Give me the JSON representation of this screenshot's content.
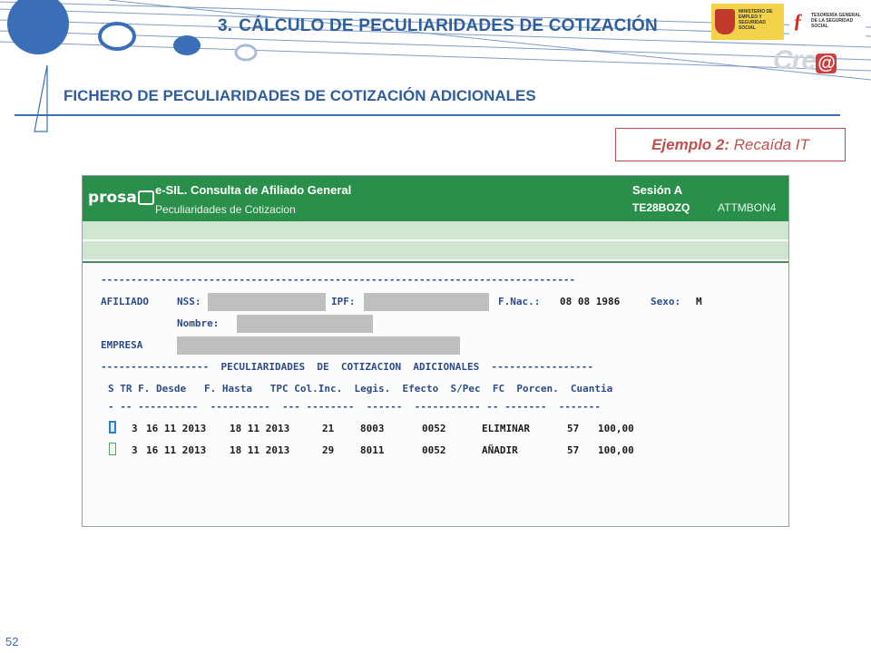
{
  "slide": {
    "title_num": "3.",
    "title": "CÁLCULO DE PECULIARIDADES DE COTIZACIÓN",
    "subtitle": "FICHERO DE PECULIARIDADES DE COTIZACIÓN ADICIONALES",
    "example_label": "Ejemplo 2:",
    "example_text": "Recaída IT",
    "page_number": "52",
    "crea_logo": "Cre",
    "crea_logo_at": "@"
  },
  "screen": {
    "logo_text": "prosa",
    "app_title": "e-SIL. Consulta de Afiliado General",
    "app_subtitle": "Peculiaridades de Cotizacion",
    "session_label": "Sesión A",
    "session_code": "TE28BOZQ",
    "transaction_code": "ATTMBON4",
    "dash_line": "-------------------------------------------------------------------------------",
    "afiliado_label": "AFILIADO",
    "nss_label": "NSS:",
    "ipf_label": "IPF:",
    "fnac_label": "F.Nac.:",
    "fnac_value": "08 08 1986",
    "sexo_label": "Sexo:",
    "sexo_value": "M",
    "nombre_label": "Nombre:",
    "empresa_label": "EMPRESA",
    "section_header": "------------------  PECULIARIDADES  DE  COTIZACION  ADICIONALES  -----------------",
    "columns_header": "S TR F. Desde   F. Hasta   TPC Col.Inc.  Legis.  Efecto  S/Pec  FC  Porcen.  Cuantia",
    "columns_underline": "- -- ----------  ----------  --- --------  ------  ----------- -- -------  -------",
    "rows": [
      {
        "tr": "3",
        "desde": "16 11 2013",
        "hasta": "18 11 2013",
        "tpc": "21",
        "colinc": "8003",
        "legis": "0052",
        "efecto": "ELIMINAR",
        "fc": "57",
        "porcen": "100,00"
      },
      {
        "tr": "3",
        "desde": "16 11 2013",
        "hasta": "18 11 2013",
        "tpc": "29",
        "colinc": "8011",
        "legis": "0052",
        "efecto": "AÑADIR",
        "fc": "57",
        "porcen": "100,00"
      }
    ]
  },
  "logos": {
    "ministerio_text": "MINISTERIO DE EMPLEO Y SEGURIDAD SOCIAL",
    "tgss_text": "TESORERÍA GENERAL DE LA SEGURIDAD SOCIAL"
  },
  "colors": {
    "title_blue": "#2f5d9e",
    "accent_red": "#c0504d",
    "screen_green": "#2a8f4a"
  }
}
